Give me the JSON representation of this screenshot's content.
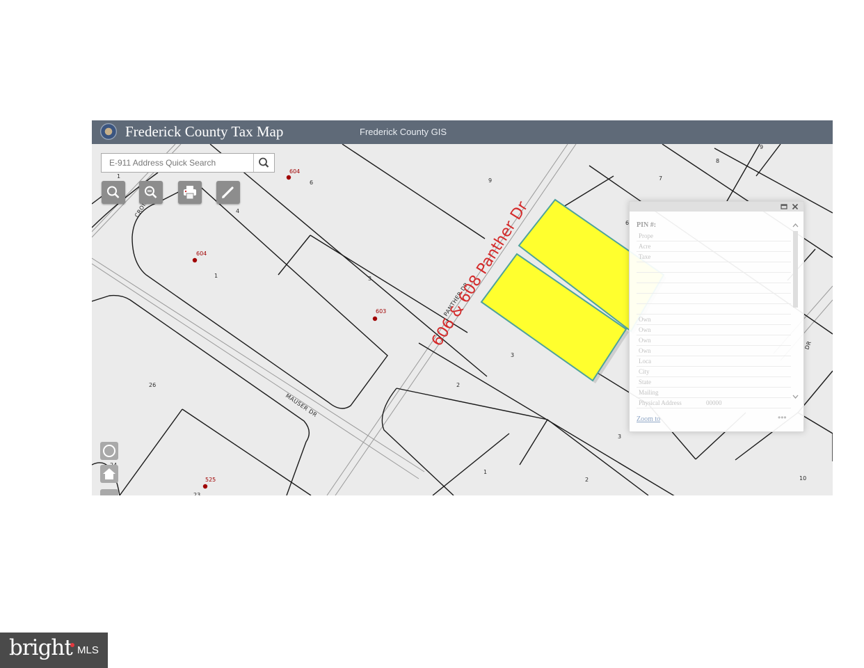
{
  "app": {
    "title": "Frederick County Tax Map",
    "subtitle": "Frederick County GIS",
    "seal_icon": "county-seal"
  },
  "search": {
    "placeholder": "E-911 Address Quick Search",
    "button_icon": "search-icon"
  },
  "toolbar": [
    {
      "name": "zoom-in-tool",
      "icon": "magnifier-icon"
    },
    {
      "name": "zoom-out-tool",
      "icon": "magnifier-minus-icon"
    },
    {
      "name": "print-tool",
      "icon": "printer-icon"
    },
    {
      "name": "draw-tool",
      "icon": "pencil-icon"
    }
  ],
  "nav_controls": [
    {
      "name": "locate-button",
      "icon": "locate-icon"
    },
    {
      "name": "home-button",
      "icon": "home-icon"
    }
  ],
  "map": {
    "annotation": "606 & 608 Panther Dr",
    "streets": [
      "PANTHER DR",
      "MAUSER DR",
      "CRONSITE",
      "DR"
    ],
    "lot_numbers": [
      "1",
      "6",
      "4",
      "1",
      "3",
      "9",
      "7",
      "8",
      "9",
      "6",
      "3",
      "2",
      "26",
      "24",
      "23",
      "1",
      "2",
      "3",
      "10"
    ],
    "address_points": [
      "604",
      "604",
      "603",
      "525"
    ],
    "colors": {
      "map_background": "#ebebeb",
      "parcel_line": "#1a1a1a",
      "address_point": "#a00000",
      "annotation": "#d42a2a",
      "highlight_fill": "#ffff2e",
      "highlight_outline": "#4fa39b"
    }
  },
  "popup": {
    "title": "PIN #:",
    "rows": [
      {
        "key": "Prope",
        "value": ""
      },
      {
        "key": "Acre",
        "value": ""
      },
      {
        "key": "Taxe",
        "value": ""
      },
      {
        "key": "",
        "value": ""
      },
      {
        "key": "",
        "value": ""
      },
      {
        "key": "",
        "value": ""
      },
      {
        "key": "",
        "value": ""
      },
      {
        "key": "",
        "value": ""
      },
      {
        "key": "Own",
        "value": ""
      },
      {
        "key": "Own",
        "value": ""
      },
      {
        "key": "Own",
        "value": ""
      },
      {
        "key": "Own",
        "value": ""
      },
      {
        "key": "Loca",
        "value": ""
      },
      {
        "key": "City",
        "value": ""
      },
      {
        "key": "State",
        "value": ""
      },
      {
        "key": "Mailing",
        "value": ""
      },
      {
        "key": "Physical Address",
        "value": "00000"
      }
    ],
    "zoom_link": "Zoom to",
    "more": "•••"
  },
  "watermark": {
    "brand": "bright",
    "suffix": "MLS"
  }
}
